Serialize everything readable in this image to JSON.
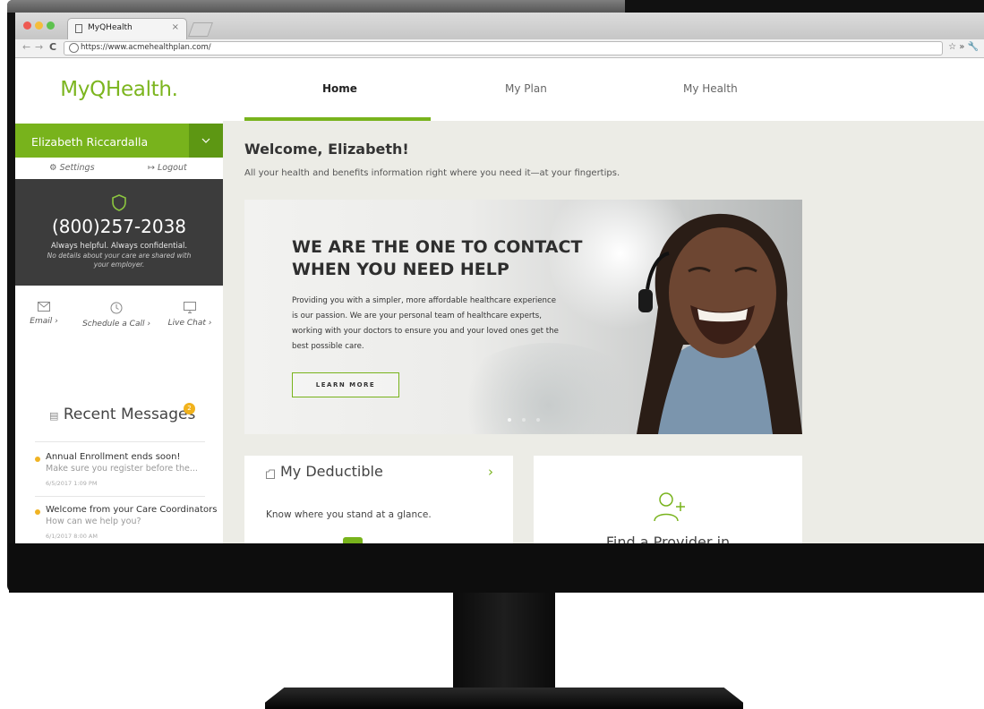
{
  "browser": {
    "tab_title": "MyQHealth",
    "tab_close": "×",
    "url": "https://www.acmehealthplan.com/",
    "right_icons": "☆ » 🔧"
  },
  "sidebar": {
    "logo": "MyQHealth.",
    "user_name": "Elizabeth Riccardalla",
    "settings_label": "Settings",
    "logout_label": "Logout",
    "phone": "(800)257-2038",
    "phone_tagline": "Always helpful. Always confidential.",
    "phone_note": "No details about your care are shared with your employer.",
    "contacts": [
      {
        "label": "Email  ›",
        "icon": "envelope-icon"
      },
      {
        "label": "Schedule a Call  ›",
        "icon": "clock-icon"
      },
      {
        "label": "Live Chat  ›",
        "icon": "monitor-icon"
      }
    ],
    "recent_title": "Recent Messages",
    "recent_count": "2",
    "messages": [
      {
        "title": "Annual Enrollment ends soon!",
        "preview": "Make sure you register before the...",
        "time": "6/5/2017  1:09 PM"
      },
      {
        "title": "Welcome from your Care Coordinators",
        "preview": "How can we help you?",
        "time": "6/1/2017  8:00 AM"
      }
    ]
  },
  "nav": {
    "tabs": [
      "Home",
      "My Plan",
      "My Health"
    ]
  },
  "main": {
    "welcome": "Welcome, Elizabeth!",
    "subtitle": "All your health and benefits information right where you need it—at your fingertips.",
    "hero": {
      "title_line1": "WE ARE THE ONE TO CONTACT",
      "title_line2": "WHEN YOU NEED HELP",
      "body": "Providing you with a simpler, more affordable healthcare experience is our passion. We are your personal team of healthcare experts, working with your doctors to ensure you and your loved ones get the best possible care.",
      "button": "LEARN MORE"
    },
    "deductible": {
      "title": "My Deductible",
      "chevron": "›",
      "text": "Know where you stand at a glance."
    },
    "provider": {
      "title": "Find a Provider in"
    }
  },
  "colors": {
    "brand_green": "#78b31c",
    "badge_yellow": "#f1b21c",
    "phone_panel": "#3c3c3c"
  }
}
